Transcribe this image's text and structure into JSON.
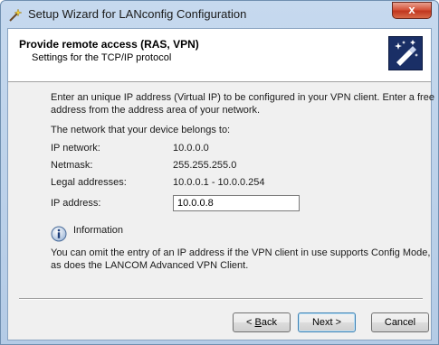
{
  "window": {
    "title": "Setup Wizard for LANconfig Configuration",
    "close_label": "x"
  },
  "header": {
    "title": "Provide remote access (RAS, VPN)",
    "subtitle": "Settings for the TCP/IP protocol",
    "logo_icon": "wizard-wand-icon"
  },
  "content": {
    "intro_line1": "Enter an unique IP address (Virtual IP) to be configured in your VPN client. Enter a free",
    "intro_line2": "address from the address area of your network.",
    "network_heading": "The network that your device belongs to:",
    "fields": [
      {
        "label": "IP network:",
        "value": "10.0.0.0"
      },
      {
        "label": "Netmask:",
        "value": "255.255.255.0"
      },
      {
        "label": "Legal addresses:",
        "value": "10.0.0.1 - 10.0.0.254"
      }
    ],
    "ip_address_label": "IP address:",
    "ip_address_value": "10.0.0.8",
    "info_label": "Information",
    "info_line1": "You can omit the entry of an IP address if the VPN client in use supports Config Mode,",
    "info_line2": "as does the LANCOM Advanced VPN Client."
  },
  "buttons": {
    "back_prefix": "< ",
    "back_mnemonic": "B",
    "back_rest": "ack",
    "next": "Next >",
    "cancel": "Cancel"
  }
}
